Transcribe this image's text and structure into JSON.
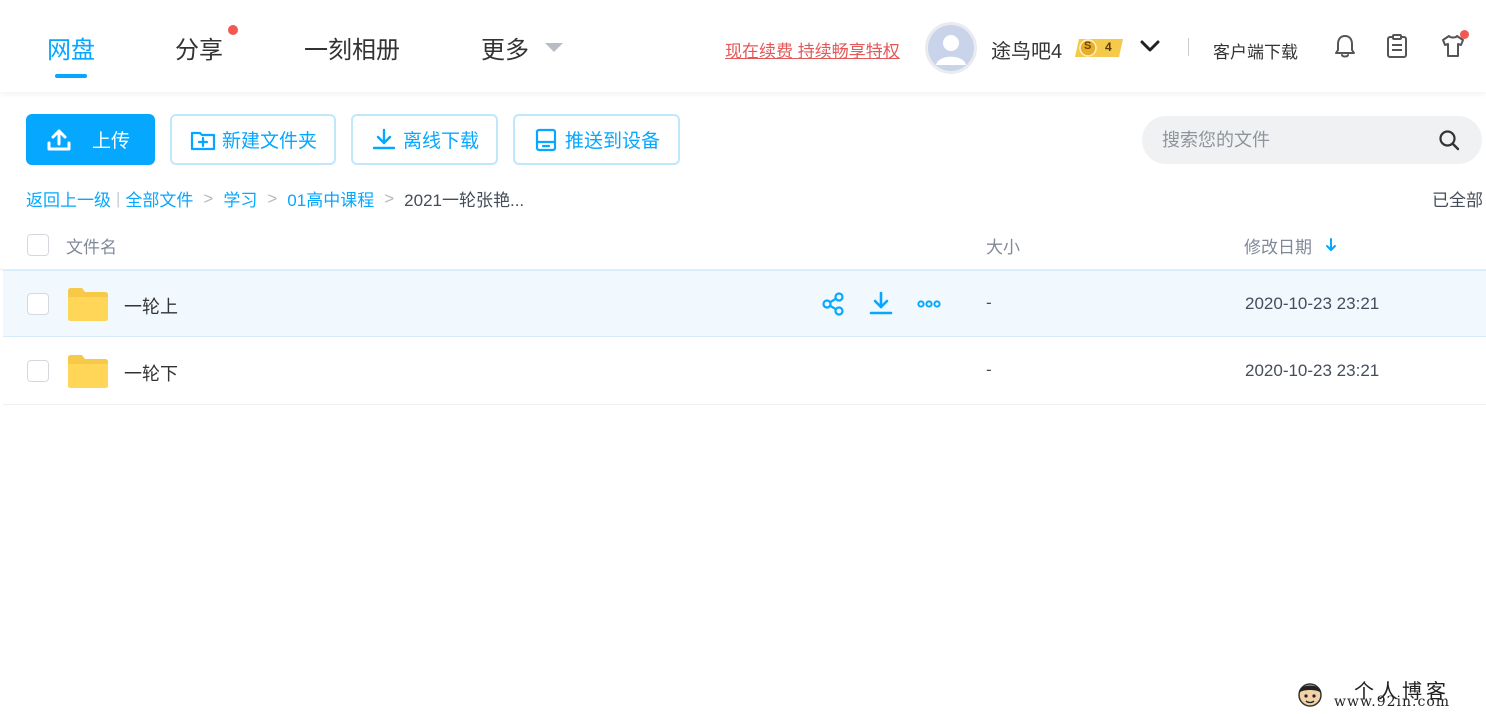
{
  "colors": {
    "accent": "#06a7ff",
    "renew_link": "#e35858",
    "notification_dot": "#f25752",
    "folder": "#ffd658",
    "row_hover_bg": "#f1f9ff"
  },
  "nav": {
    "items": [
      {
        "label": "网盘",
        "active": true
      },
      {
        "label": "分享",
        "has_dot": true
      },
      {
        "label": "一刻相册"
      },
      {
        "label": "更多",
        "has_caret": true
      }
    ]
  },
  "header": {
    "renew_link": "现在续费 持续畅享特权",
    "username": "途鸟吧4",
    "vip_level": "4",
    "vip_badge_letter": "S",
    "client_download": "客户端下载",
    "icons": [
      "bell-icon",
      "clipboard-icon",
      "tshirt-icon"
    ]
  },
  "toolbar": {
    "upload_label": "上传",
    "new_folder_label": "新建文件夹",
    "offline_download_label": "离线下载",
    "push_device_label": "推送到设备"
  },
  "search": {
    "placeholder": "搜索您的文件"
  },
  "breadcrumb": {
    "back": "返回上一级",
    "items": [
      "全部文件",
      "学习",
      "01高中课程"
    ],
    "current": "2021一轮张艳...",
    "loaded_status": "已全部"
  },
  "file_list": {
    "columns": {
      "name": "文件名",
      "size": "大小",
      "modified": "修改日期"
    },
    "sort": {
      "column": "modified",
      "direction": "desc"
    },
    "rows": [
      {
        "name": "一轮上",
        "type": "folder",
        "size": "-",
        "modified": "2020-10-23 23:21",
        "hovered": true
      },
      {
        "name": "一轮下",
        "type": "folder",
        "size": "-",
        "modified": "2020-10-23 23:21",
        "hovered": false
      }
    ],
    "row_actions": [
      "share-icon",
      "download-icon",
      "more-icon"
    ]
  },
  "watermark": {
    "title": "个人博客",
    "url": "www.92in.com"
  }
}
